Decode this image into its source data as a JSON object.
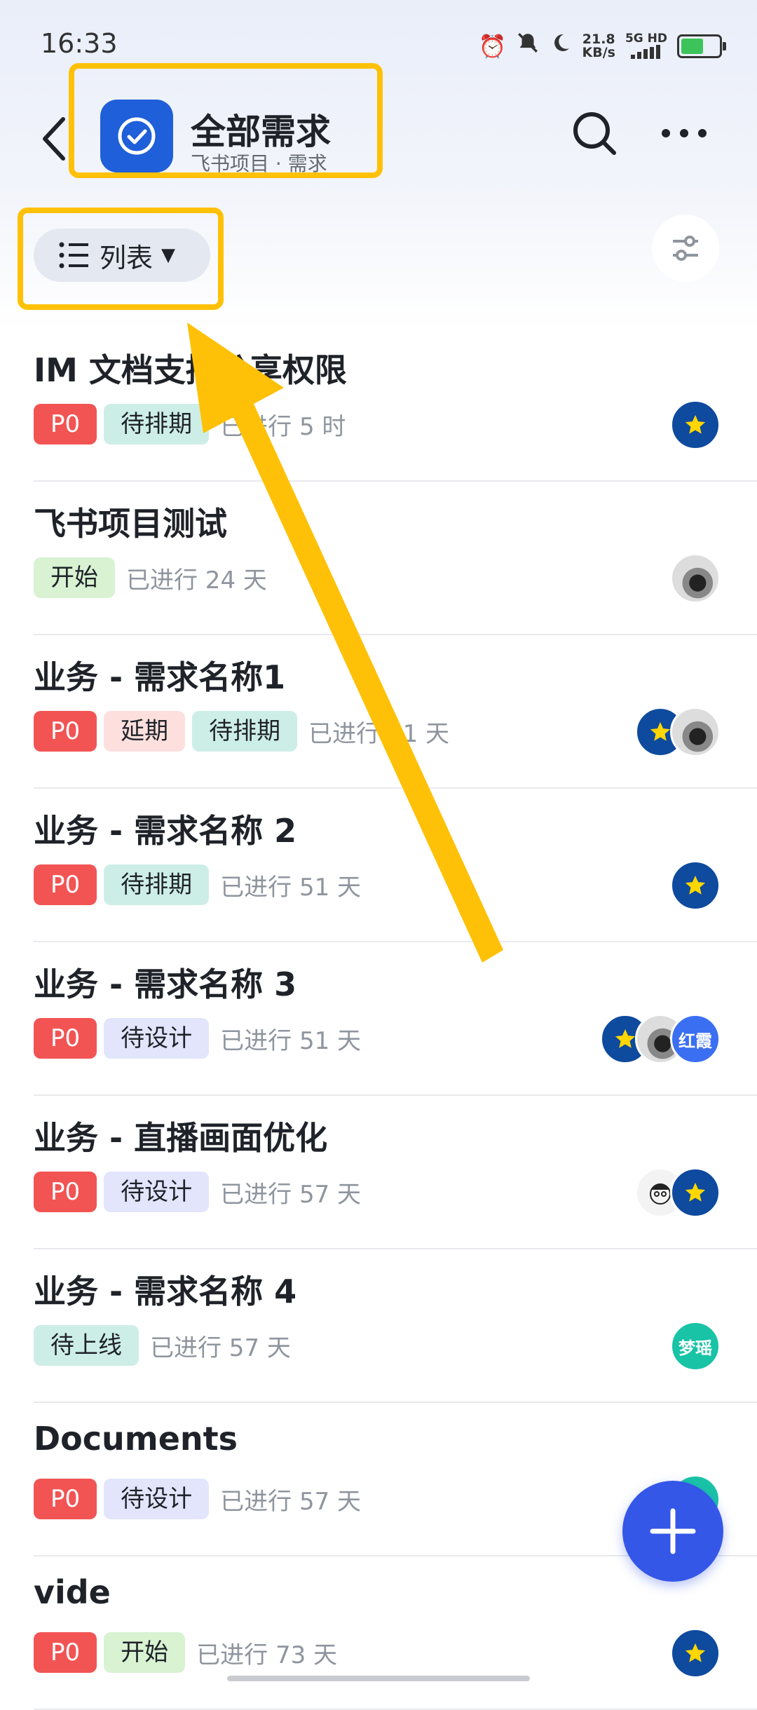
{
  "status_bar": {
    "time": "16:33",
    "net_speed_value": "21.8",
    "net_speed_unit": "KB/s",
    "network_type": "5G HD",
    "battery_level_percent": 60,
    "icons": [
      "alarm-icon",
      "mute-bell-icon",
      "moon-icon",
      "signal-icon",
      "battery-icon"
    ]
  },
  "header": {
    "title": "全部需求",
    "subtitle": "飞书项目 · 需求",
    "app_icon": "check-circle-icon",
    "actions": [
      "search-icon",
      "more-icon"
    ]
  },
  "toolbar": {
    "view_label": "列表",
    "view_icon": "list-icon",
    "filter_icon": "filter-sliders-icon"
  },
  "items": [
    {
      "title": "IM 文档支持分享权限",
      "tags": [
        {
          "text": "P0",
          "style": "p0"
        },
        {
          "text": "待排期",
          "style": "mint"
        }
      ],
      "elapsed": "已进行 5 时",
      "avatars": [
        {
          "type": "star"
        }
      ]
    },
    {
      "title": "飞书项目测试",
      "tags": [
        {
          "text": "开始",
          "style": "green"
        }
      ],
      "elapsed": "已进行 24 天",
      "avatars": [
        {
          "type": "photo"
        }
      ]
    },
    {
      "title": "业务 - 需求名称1",
      "tags": [
        {
          "text": "P0",
          "style": "p0"
        },
        {
          "text": "延期",
          "style": "pink"
        },
        {
          "text": "待排期",
          "style": "mint"
        }
      ],
      "elapsed": "已进行 51 天",
      "avatars": [
        {
          "type": "star"
        },
        {
          "type": "photo"
        }
      ]
    },
    {
      "title": "业务 - 需求名称 2",
      "tags": [
        {
          "text": "P0",
          "style": "p0"
        },
        {
          "text": "待排期",
          "style": "mint"
        }
      ],
      "elapsed": "已进行 51 天",
      "avatars": [
        {
          "type": "star"
        }
      ]
    },
    {
      "title": "业务 - 需求名称 3",
      "tags": [
        {
          "text": "P0",
          "style": "p0"
        },
        {
          "text": "待设计",
          "style": "lav"
        }
      ],
      "elapsed": "已进行 51 天",
      "avatars": [
        {
          "type": "star"
        },
        {
          "type": "photo"
        },
        {
          "type": "text",
          "text": "红霞",
          "color": "blue"
        }
      ]
    },
    {
      "title": "业务 - 直播画面优化",
      "tags": [
        {
          "text": "P0",
          "style": "p0"
        },
        {
          "text": "待设计",
          "style": "lav"
        }
      ],
      "elapsed": "已进行 57 天",
      "avatars": [
        {
          "type": "sketch"
        },
        {
          "type": "star"
        }
      ]
    },
    {
      "title": "业务 - 需求名称 4",
      "tags": [
        {
          "text": "待上线",
          "style": "mint"
        }
      ],
      "elapsed": "已进行 57 天",
      "avatars": [
        {
          "type": "text",
          "text": "梦瑶",
          "color": "teal"
        }
      ]
    },
    {
      "title": "Documents",
      "tags": [
        {
          "text": "P0",
          "style": "p0"
        },
        {
          "text": "待设计",
          "style": "lav"
        }
      ],
      "elapsed": "已进行 57 天",
      "avatars": [
        {
          "type": "text",
          "text": "",
          "color": "teal"
        }
      ]
    },
    {
      "title": "vide",
      "tags": [
        {
          "text": "P0",
          "style": "p0"
        },
        {
          "text": "开始",
          "style": "green"
        }
      ],
      "elapsed": "已进行 73 天",
      "avatars": [
        {
          "type": "star"
        }
      ]
    }
  ],
  "fab": {
    "icon": "plus-icon"
  },
  "annotation": {
    "color": "#ffc107",
    "arrow_icon": "arrow-annotation-icon"
  },
  "colors": {
    "accent": "#3457e8",
    "p0_tag": "#f25454",
    "app_icon_bg": "#1f5fd9"
  }
}
